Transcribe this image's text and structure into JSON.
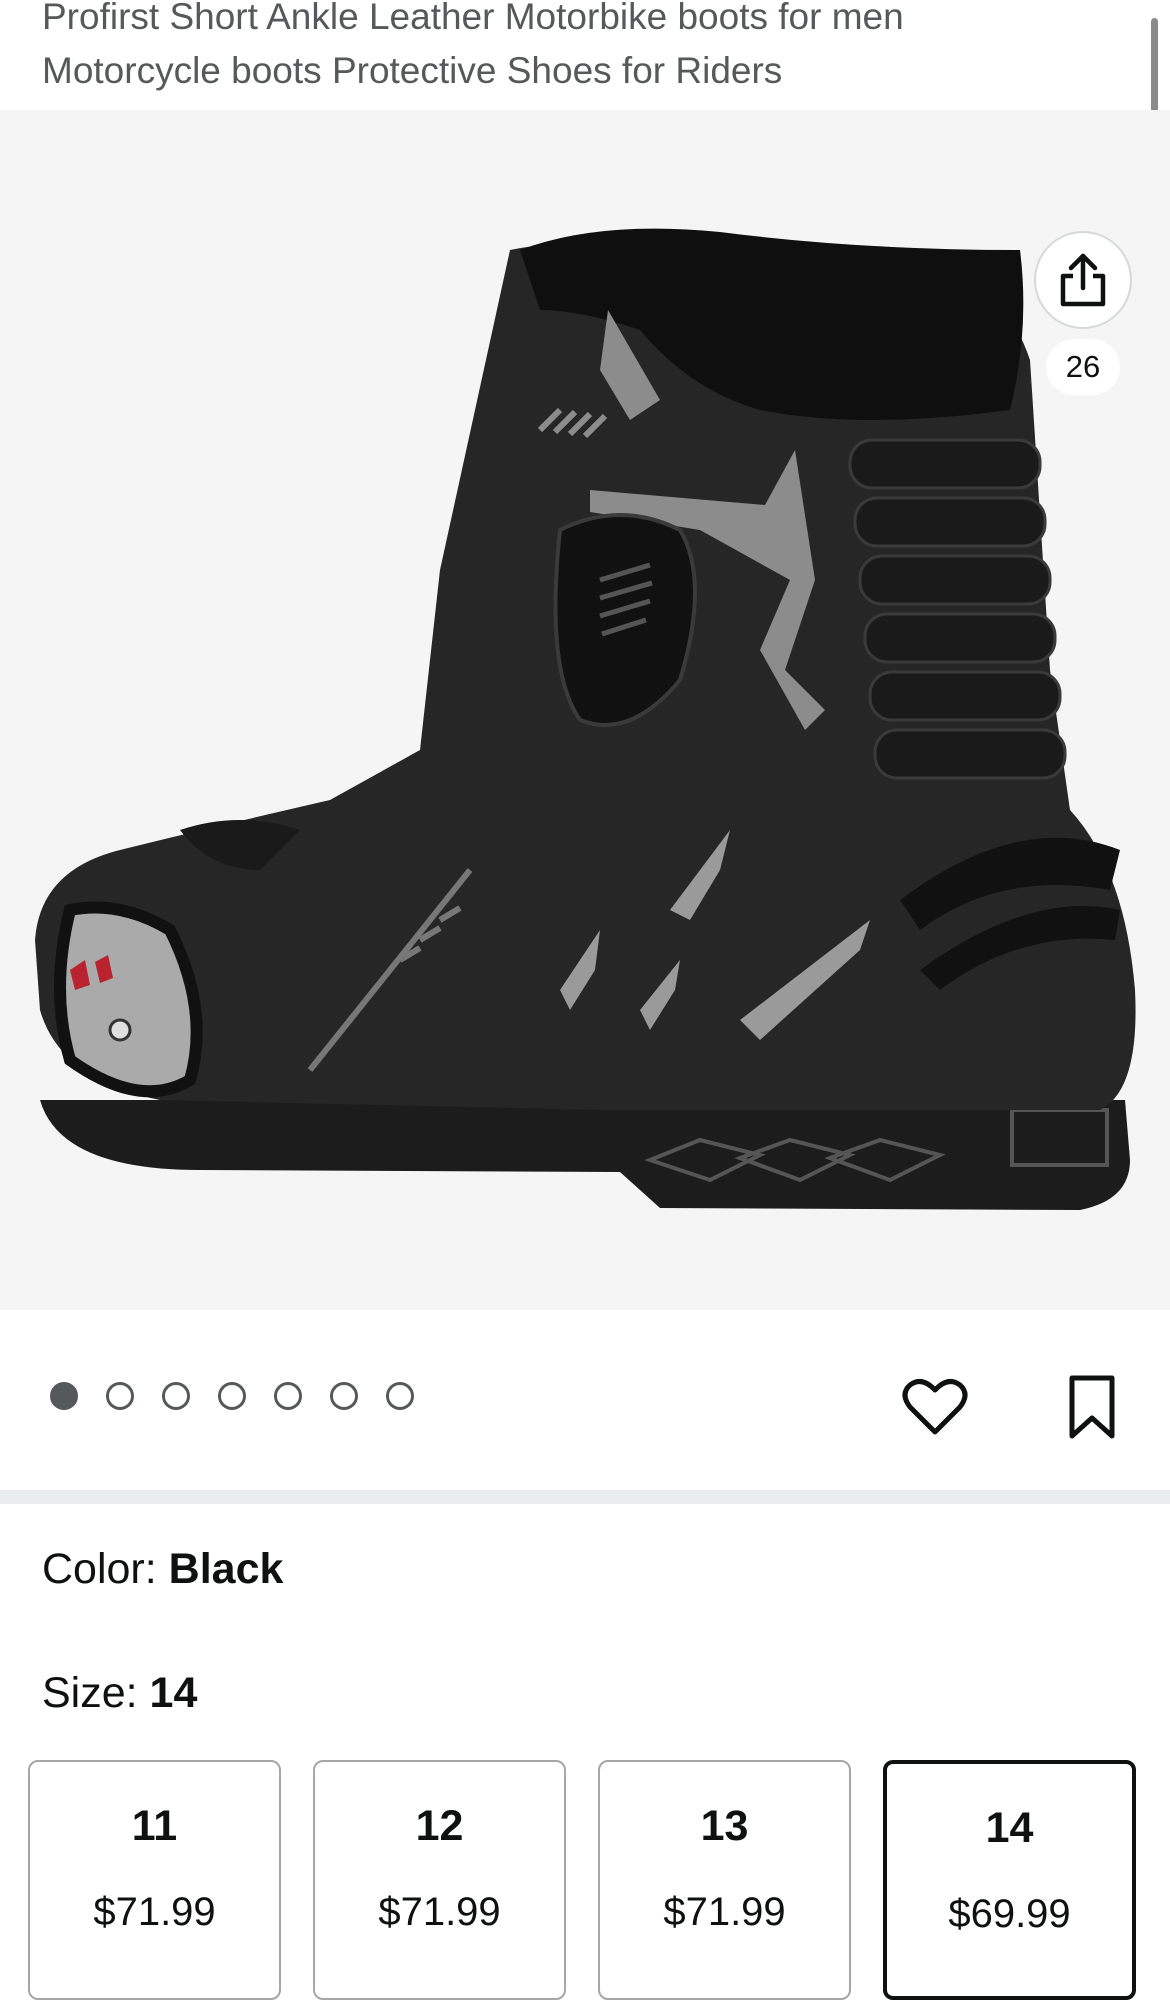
{
  "product": {
    "title": "Profirst Short Ankle Leather Motorbike boots for men Motorcycle boots Protective Shoes for Riders"
  },
  "gallery": {
    "image_count": "26",
    "share_icon": "share-icon",
    "dot_count": 7,
    "active_dot": 0,
    "background": "#f5f5f5"
  },
  "actions": {
    "heart_icon": "heart-icon",
    "bookmark_icon": "bookmark-icon"
  },
  "variation": {
    "color_label": "Color: ",
    "color_value": "Black",
    "size_label": "Size: ",
    "size_value": "14"
  },
  "sizes": [
    {
      "size": "11",
      "price": "$71.99",
      "selected": false
    },
    {
      "size": "12",
      "price": "$71.99",
      "selected": false
    },
    {
      "size": "13",
      "price": "$71.99",
      "selected": false
    },
    {
      "size": "14",
      "price": "$69.99",
      "selected": true
    }
  ],
  "colors": {
    "text": "#0f1111",
    "muted": "#565959",
    "divider": "#eaeded"
  }
}
